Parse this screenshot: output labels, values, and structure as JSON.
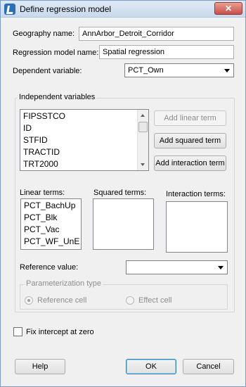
{
  "window": {
    "title": "Define regression model",
    "close_glyph": "✕"
  },
  "form": {
    "geography_label": "Geography name:",
    "geography_value": "AnnArbor_Detroit_Corridor",
    "model_label": "Regression model name:",
    "model_value": "Spatial regression",
    "dependent_label": "Dependent variable:",
    "dependent_value": "PCT_Own"
  },
  "independent": {
    "group_label": "Independent variables",
    "items": [
      "FIPSSTCO",
      "ID",
      "STFID",
      "TRACTID",
      "TRT2000"
    ],
    "add_linear": "Add linear term",
    "add_squared": "Add squared term",
    "add_interaction": "Add interaction term",
    "linear_label": "Linear terms:",
    "squared_label": "Squared terms:",
    "interaction_label": "Interaction terms:",
    "linear_terms": [
      "PCT_BachUp",
      "PCT_Blk",
      "PCT_Vac",
      "PCT_WF_UnE"
    ],
    "reference_label": "Reference value:",
    "reference_value": "",
    "param_group_label": "Parameterization type",
    "reference_cell_label": "Reference cell",
    "effect_cell_label": "Effect cell"
  },
  "intercept": {
    "label": "Fix intercept at zero"
  },
  "buttons": {
    "help": "Help",
    "ok": "OK",
    "cancel": "Cancel"
  }
}
